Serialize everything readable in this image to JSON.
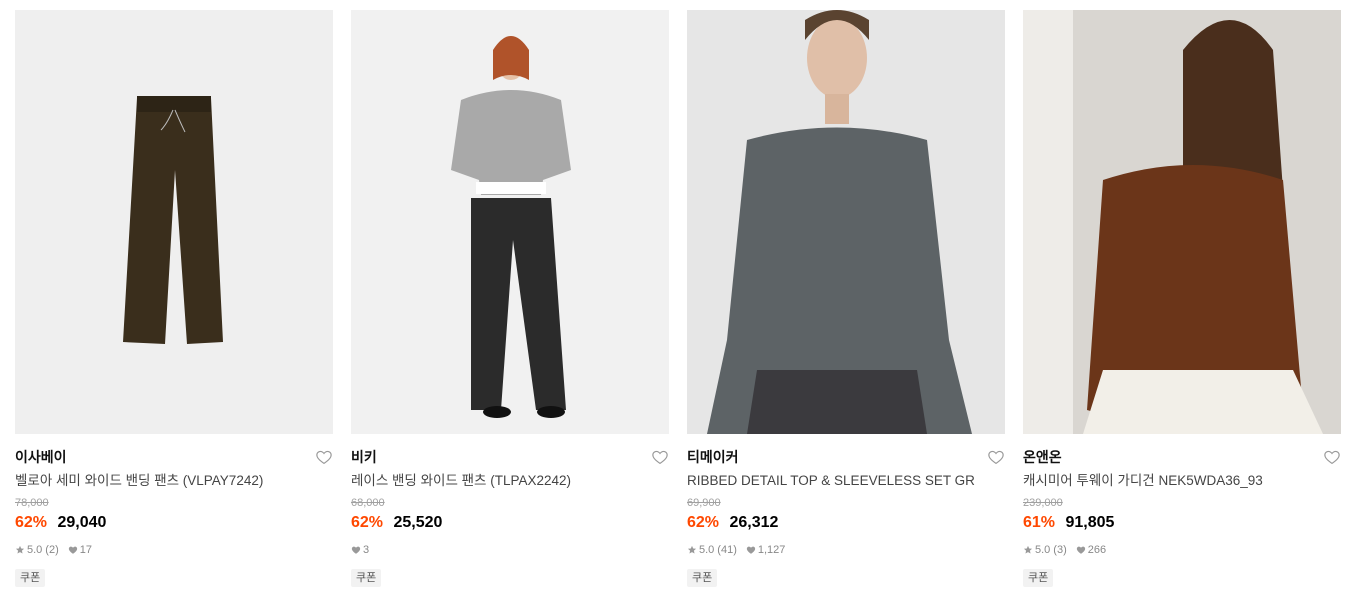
{
  "products": [
    {
      "brand": "이사베이",
      "name": "벨로아 세미 와이드 밴딩 팬츠 (VLPAY7242)",
      "original_price": "78,000",
      "discount": "62%",
      "price": "29,040",
      "rating": "5.0",
      "reviews": "(2)",
      "likes": "17",
      "badge": "쿠폰",
      "image_bg": "#efefef",
      "garment_color": "#3a2e1c",
      "like_icon": "heart-outline-icon"
    },
    {
      "brand": "비키",
      "name": "레이스 밴딩 와이드 팬츠 (TLPAX2242)",
      "original_price": "68,000",
      "discount": "62%",
      "price": "25,520",
      "rating": "",
      "reviews": "",
      "likes": "3",
      "badge": "쿠폰",
      "image_bg": "#f1f1f1",
      "garment_color": "#2b2b2b",
      "like_icon": "heart-outline-icon"
    },
    {
      "brand": "티메이커",
      "name": "RIBBED DETAIL TOP & SLEEVELESS SET GR",
      "original_price": "69,900",
      "discount": "62%",
      "price": "26,312",
      "rating": "5.0",
      "reviews": "(41)",
      "likes": "1,127",
      "badge": "쿠폰",
      "image_bg": "#e6e6e6",
      "garment_color": "#5d6366",
      "like_icon": "heart-outline-icon"
    },
    {
      "brand": "온앤온",
      "name": "캐시미어 투웨이 가디건 NEK5WDA36_93",
      "original_price": "239,000",
      "discount": "61%",
      "price": "91,805",
      "rating": "5.0",
      "reviews": "(3)",
      "likes": "266",
      "badge": "쿠폰",
      "image_bg": "#d9d6d1",
      "garment_color": "#6b3519",
      "like_icon": "heart-outline-icon"
    }
  ],
  "colors": {
    "discount": "#ff4800",
    "strike": "#a0a0a0"
  }
}
